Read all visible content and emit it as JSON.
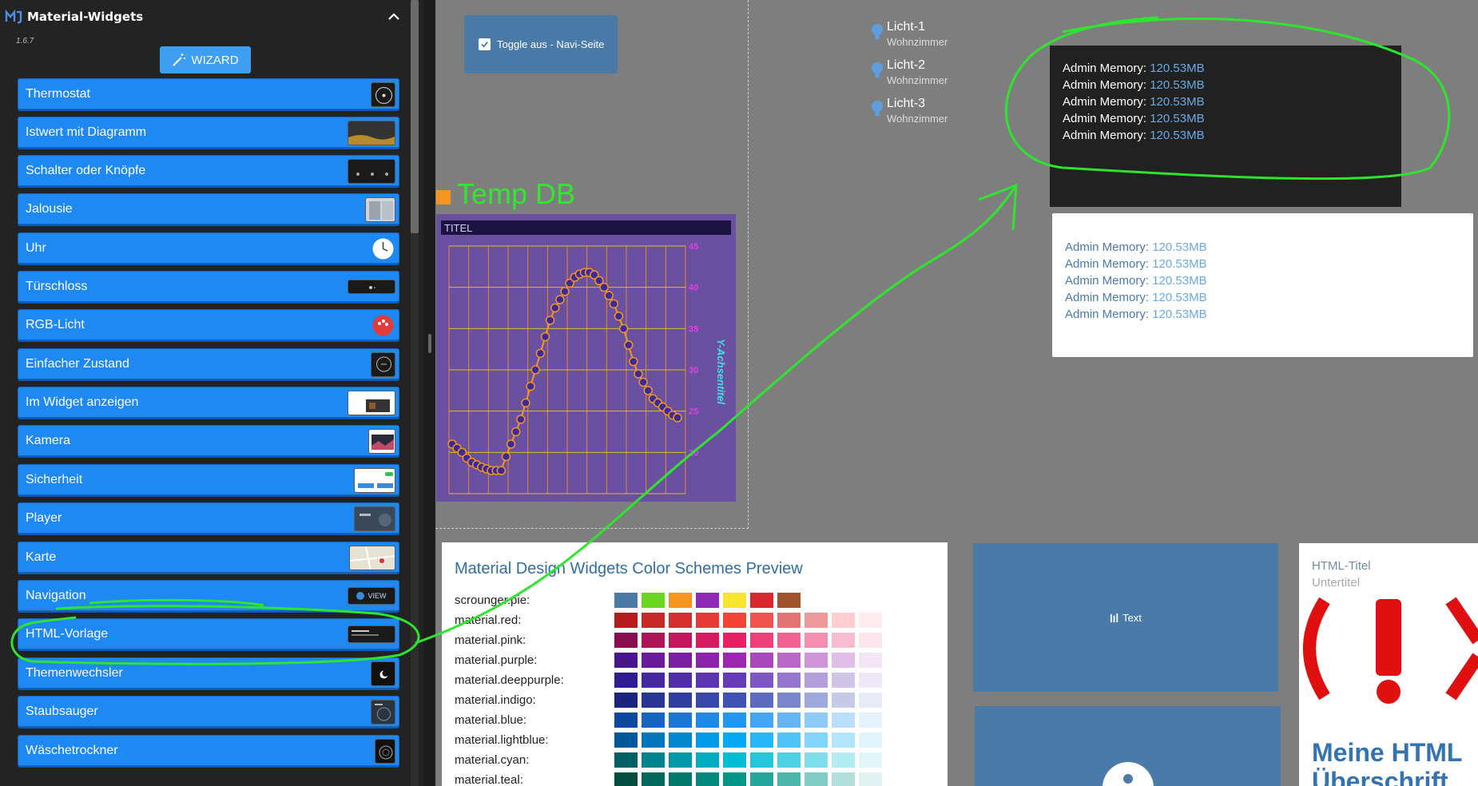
{
  "sidebar": {
    "title": "Material-Widgets",
    "version": "1.6.7",
    "wizard_label": "WIZARD",
    "items": [
      {
        "label": "Thermostat"
      },
      {
        "label": "Istwert mit Diagramm"
      },
      {
        "label": "Schalter oder Knöpfe"
      },
      {
        "label": "Jalousie"
      },
      {
        "label": "Uhr"
      },
      {
        "label": "Türschloss"
      },
      {
        "label": "RGB-Licht"
      },
      {
        "label": "Einfacher Zustand"
      },
      {
        "label": "Im Widget anzeigen"
      },
      {
        "label": "Kamera"
      },
      {
        "label": "Sicherheit"
      },
      {
        "label": "Player"
      },
      {
        "label": "Karte"
      },
      {
        "label": "Navigation",
        "thumb_label": "VIEW"
      },
      {
        "label": "HTML-Vorlage"
      },
      {
        "label": "Themenwechsler"
      },
      {
        "label": "Staubsauger"
      },
      {
        "label": "Wäschetrockner"
      }
    ]
  },
  "canvas": {
    "toggle_label": "Toggle aus - Navi-Seite",
    "lights": [
      {
        "name": "Licht-1",
        "room": "Wohnzimmer"
      },
      {
        "name": "Licht-2",
        "room": "Wohnzimmer"
      },
      {
        "name": "Licht-3",
        "room": "Wohnzimmer"
      }
    ],
    "memory_dark": [
      {
        "key": "Admin Memory:",
        "value": "120.53MB"
      },
      {
        "key": "Admin Memory:",
        "value": "120.53MB"
      },
      {
        "key": "Admin Memory:",
        "value": "120.53MB"
      },
      {
        "key": "Admin Memory:",
        "value": "120.53MB"
      },
      {
        "key": "Admin Memory:",
        "value": "120.53MB"
      }
    ],
    "memory_light": [
      {
        "key": "Admin Memory:",
        "value": "120.53MB"
      },
      {
        "key": "Admin Memory:",
        "value": "120.53MB"
      },
      {
        "key": "Admin Memory:",
        "value": "120.53MB"
      },
      {
        "key": "Admin Memory:",
        "value": "120.53MB"
      },
      {
        "key": "Admin Memory:",
        "value": "120.53MB"
      }
    ],
    "text_tile_label": "Text",
    "html_card": {
      "title": "HTML-Titel",
      "subtitle": "Untertitel",
      "heading": "Meine HTML Überschrift"
    }
  },
  "chart_data": {
    "type": "line",
    "title": "Temp DB",
    "inner_title": "TITEL",
    "ylabel": "Y-Achsentitel",
    "y_ticks": [
      20,
      25,
      30,
      35,
      40,
      45
    ],
    "ylim": [
      15,
      45
    ],
    "series": [
      {
        "values": [
          21,
          20.5,
          20,
          19.3,
          18.8,
          18.5,
          18.2,
          18,
          17.8,
          17.8,
          17.8,
          19.5,
          21,
          22.5,
          24,
          26,
          28,
          30,
          32,
          34,
          36,
          37.5,
          38.5,
          39.5,
          40.5,
          41.2,
          41.6,
          41.8,
          41.8,
          41.5,
          40.8,
          40,
          39,
          38,
          36.5,
          35,
          33,
          31,
          29.5,
          28.5,
          27.5,
          26.5,
          26,
          25.5,
          25,
          24.5,
          24.2
        ]
      }
    ],
    "colors": {
      "background": "#6950a1",
      "grid": "#e0c020",
      "line": "#f5941f",
      "marker": "#3a2a9a",
      "tick": "#e040e0",
      "title": "#2eea2e"
    }
  },
  "color_schemes": {
    "title": "Material Design Widgets Color Schemes Preview",
    "rows": [
      {
        "name": "scrounger.pie:",
        "colors": [
          "#4a7aa8",
          "#6ad61e",
          "#f5941f",
          "#8e2ab5",
          "#f5e531",
          "#d8282e",
          "#a0522d"
        ]
      },
      {
        "name": "material.red:",
        "colors": [
          "#b71c1c",
          "#c62828",
          "#d32f2f",
          "#e53935",
          "#f44336",
          "#ef5350",
          "#e57373",
          "#ef9a9a",
          "#ffcdd2",
          "#ffebee"
        ]
      },
      {
        "name": "material.pink:",
        "colors": [
          "#880e4f",
          "#ad1457",
          "#c2185b",
          "#d81b60",
          "#e91e63",
          "#ec407a",
          "#f06292",
          "#f48fb1",
          "#f8bbd0",
          "#fce4ec"
        ]
      },
      {
        "name": "material.purple:",
        "colors": [
          "#4a148c",
          "#6a1b9a",
          "#7b1fa2",
          "#8e24aa",
          "#9c27b0",
          "#ab47bc",
          "#ba68c8",
          "#ce93d8",
          "#e1bee7",
          "#f3e5f5"
        ]
      },
      {
        "name": "material.deeppurple:",
        "colors": [
          "#311b92",
          "#4527a0",
          "#512da8",
          "#5e35b1",
          "#673ab7",
          "#7e57c2",
          "#9575cd",
          "#b39ddb",
          "#d1c4e9",
          "#ede7f6"
        ]
      },
      {
        "name": "material.indigo:",
        "colors": [
          "#1a237e",
          "#283593",
          "#303f9f",
          "#3949ab",
          "#3f51b5",
          "#5c6bc0",
          "#7986cb",
          "#9fa8da",
          "#c5cae9",
          "#e8eaf6"
        ]
      },
      {
        "name": "material.blue:",
        "colors": [
          "#0d47a1",
          "#1565c0",
          "#1976d2",
          "#1e88e5",
          "#2196f3",
          "#42a5f5",
          "#64b5f6",
          "#90caf9",
          "#bbdefb",
          "#e3f2fd"
        ]
      },
      {
        "name": "material.lightblue:",
        "colors": [
          "#01579b",
          "#0277bd",
          "#0288d1",
          "#039be5",
          "#03a9f4",
          "#29b6f6",
          "#4fc3f7",
          "#81d4fa",
          "#b3e5fc",
          "#e1f5fe"
        ]
      },
      {
        "name": "material.cyan:",
        "colors": [
          "#006064",
          "#00838f",
          "#0097a7",
          "#00acc1",
          "#00bcd4",
          "#26c6da",
          "#4dd0e1",
          "#80deea",
          "#b2ebf2",
          "#e0f7fa"
        ]
      },
      {
        "name": "material.teal:",
        "colors": [
          "#004d40",
          "#00695c",
          "#00796b",
          "#00897b",
          "#009688",
          "#26a69a",
          "#4db6ac",
          "#80cbc4",
          "#b2dfdb",
          "#e0f2f1"
        ]
      }
    ]
  }
}
